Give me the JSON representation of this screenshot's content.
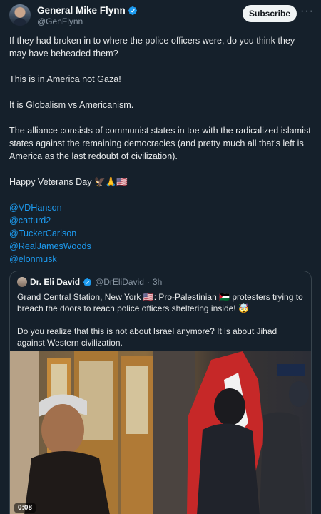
{
  "author": {
    "display_name": "General Mike Flynn",
    "handle": "@GenFlynn",
    "verified_icon": "verified-badge-icon"
  },
  "header": {
    "subscribe_label": "Subscribe",
    "more_label": "···"
  },
  "tweet": {
    "paragraphs": [
      "If they had broken in to where the police officers were, do you think they may have beheaded them?",
      "This is in America not Gaza!",
      "It is Globalism vs Americanism.",
      "The alliance consists of communist states in toe with the radicalized islamist states against the remaining democracies (and pretty much all that’s left is America as the last redoubt of civilization).",
      "Happy Veterans Day 🦅🙏🇺🇸"
    ],
    "mentions": [
      "@VDHanson",
      "@catturd2",
      "@TuckerCarlson",
      "@RealJamesWoods",
      "@elonmusk"
    ]
  },
  "quote": {
    "display_name": "Dr. Eli David",
    "handle": "@DrEliDavid",
    "separator": "·",
    "time": "3h",
    "paragraphs": [
      "Grand Central Station, New York 🇺🇸: Pro-Palestinian 🇵🇸 protesters trying to breach the doors to reach police officers sheltering inside! 🤯",
      "Do you realize that this is not about Israel anymore? It is about Jihad against Western civilization."
    ],
    "video_duration": "0:08"
  },
  "colors": {
    "background": "#15202b",
    "link": "#1d9bf0",
    "verified": "#1d9bf0",
    "muted": "#8b98a5"
  }
}
